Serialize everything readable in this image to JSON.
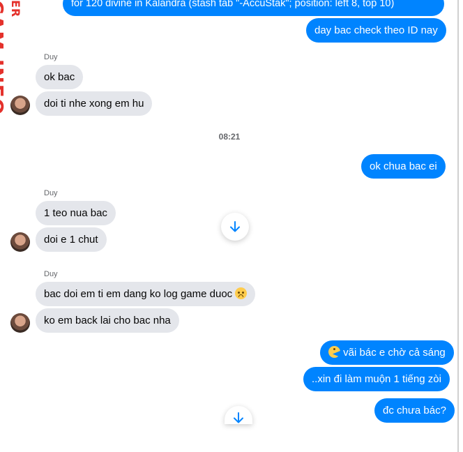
{
  "watermark": {
    "top_text": "ER",
    "main_text": "CAM.INFO"
  },
  "messages": {
    "out_1": "for 120 divine in Kalandra (stash tab \"-AccuStak\"; position: left 8, top 10)",
    "out_2": "day bac check theo ID nay",
    "sender_1": "Duy",
    "in_1": "ok bac",
    "in_2": "doi ti nhe xong em hu",
    "timestamp": "08:21",
    "out_3": "ok chua bac ei",
    "sender_2": "Duy",
    "in_3": "1 teo nua bac",
    "in_4": "doi e 1 chut",
    "sender_3": "Duy",
    "in_5": "bac doi em ti em dang ko log game duoc",
    "in_6": "ko em back lai cho bac nha",
    "out_4": "vãi bác e chờ cả sáng",
    "out_5": "..xin đi làm muộn 1 tiếng zòi",
    "out_6": "đc chưa bác?"
  },
  "icons": {
    "scroll_down": "arrow-down-icon",
    "sad_emoji": "disappointed-face-emoji",
    "pacman_emoji": "pacman-emoji"
  },
  "colors": {
    "outgoing_bubble": "#0084ff",
    "incoming_bubble": "#e4e6eb",
    "watermark": "#e4312b"
  }
}
